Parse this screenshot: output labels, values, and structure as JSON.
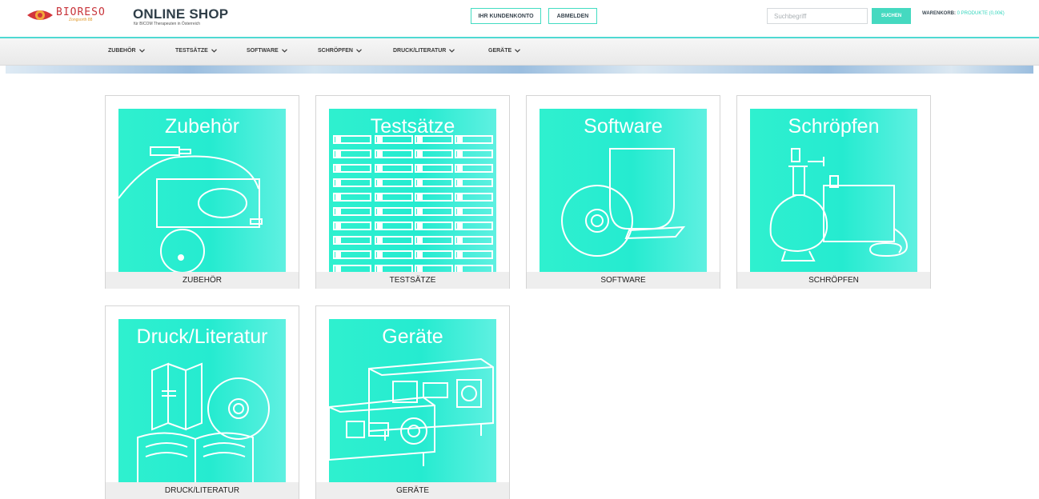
{
  "brand": {
    "logo_name": "BIORESO",
    "logo_sub": "Zongsorth 88",
    "title": "ONLINE SHOP",
    "subtitle": "für BICOM Therapeuten in Österreich"
  },
  "header": {
    "account_label": "IHR KUNDENKONTO",
    "logout_label": "ABMELDEN",
    "search_placeholder": "Suchbegriff",
    "search_button": "SUCHEN",
    "cart_label": "WARENKORB:",
    "cart_value": "0 PRODUKTE (0,00€)"
  },
  "nav": {
    "items": [
      {
        "label": "ZUBEHÖR"
      },
      {
        "label": "TESTSÄTZE"
      },
      {
        "label": "SOFTWARE"
      },
      {
        "label": "SCHRÖPFEN"
      },
      {
        "label": "DRUCK/LITERATUR"
      },
      {
        "label": "GERÄTE"
      }
    ]
  },
  "categories": [
    {
      "heading": "Zubehör",
      "caption": "ZUBEHÖR",
      "icon": "accessories-icon"
    },
    {
      "heading": "Testsätze",
      "caption": "TESTSÄTZE",
      "icon": "test-sets-icon"
    },
    {
      "heading": "Software",
      "caption": "SOFTWARE",
      "icon": "software-icon"
    },
    {
      "heading": "Schröpfen",
      "caption": "SCHRÖPFEN",
      "icon": "cupping-icon"
    },
    {
      "heading": "Druck/Literatur",
      "caption": "DRUCK/LITERATUR",
      "icon": "literature-icon"
    },
    {
      "heading": "Geräte",
      "caption": "GERÄTE",
      "icon": "devices-icon"
    }
  ],
  "colors": {
    "accent": "#45d9c0",
    "tile_gradient_start": "#2ff0cf",
    "tile_gradient_end": "#5ff0e1",
    "logo_red": "#c8343a"
  }
}
